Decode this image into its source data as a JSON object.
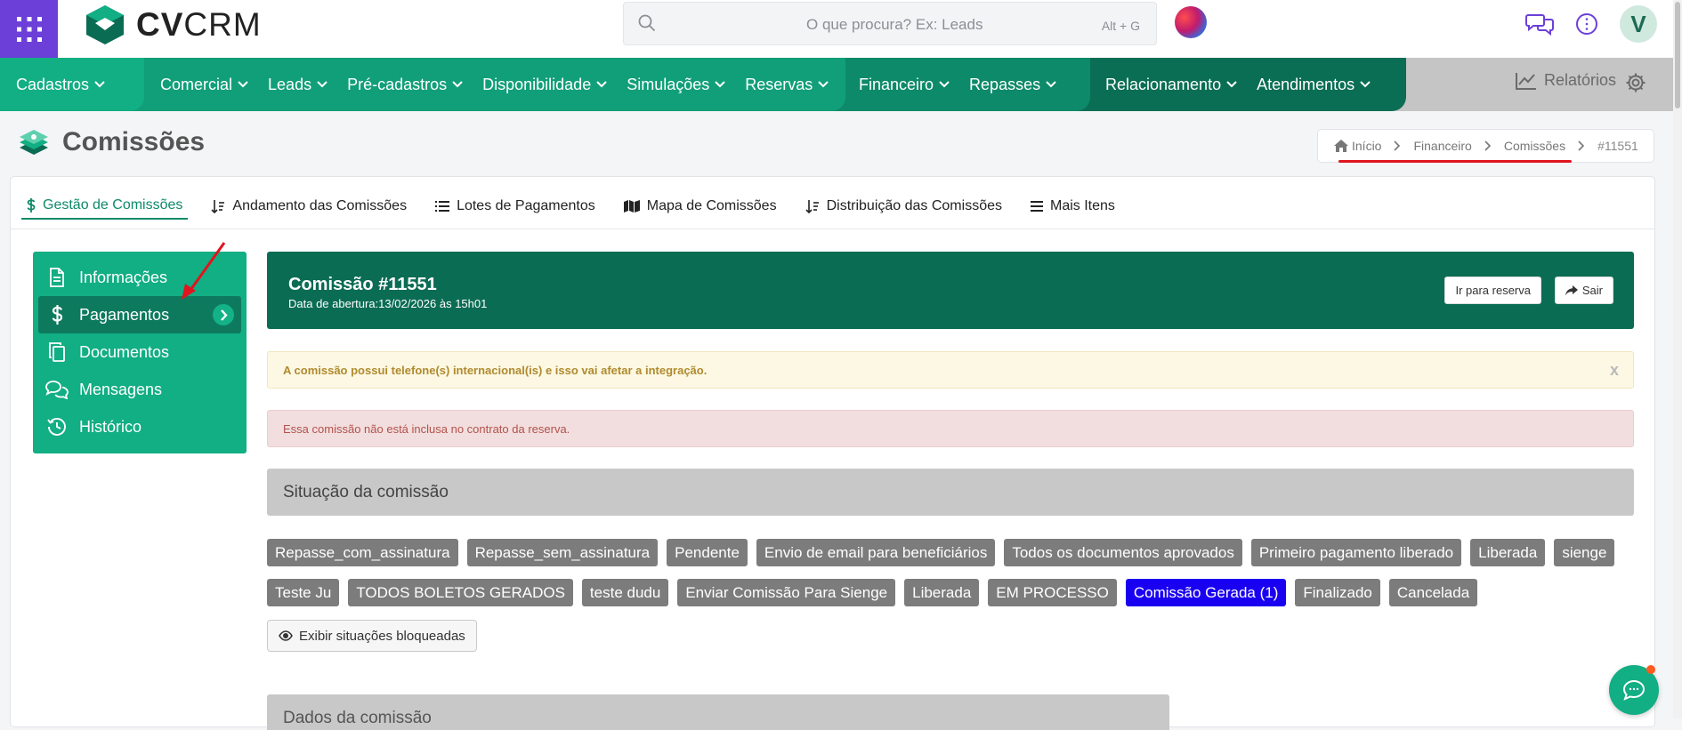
{
  "header": {
    "logo_text": "CVCRM",
    "search_placeholder": "O que procura? Ex: Leads",
    "search_shortcut": "Alt + G",
    "user_initial": "V"
  },
  "nav": {
    "group1": [
      "Cadastros"
    ],
    "group2": [
      "Comercial",
      "Leads",
      "Pré-cadastros",
      "Disponibilidade",
      "Simulações",
      "Reservas"
    ],
    "group3": [
      "Financeiro",
      "Repasses"
    ],
    "group4": [
      "Relacionamento",
      "Atendimentos"
    ],
    "reports_label": "Relatórios"
  },
  "page": {
    "title": "Comissões",
    "breadcrumb": [
      "Início",
      "Financeiro",
      "Comissões",
      "#11551"
    ]
  },
  "tabs": [
    "Gestão de Comissões",
    "Andamento das Comissões",
    "Lotes de Pagamentos",
    "Mapa de Comissões",
    "Distribuição das Comissões",
    "Mais Itens"
  ],
  "sidemenu": [
    "Informações",
    "Pagamentos",
    "Documentos",
    "Mensagens",
    "Histórico"
  ],
  "commission": {
    "title": "Comissão #11551",
    "subtitle": "Data de abertura:13/02/2026 às 15h01",
    "btn_reserva": "Ir para reserva",
    "btn_sair": "Sair"
  },
  "alerts": {
    "warning": "A comissão possui telefone(s) internacional(is) e isso vai afetar a integração.",
    "warning_close": "x",
    "danger": "Essa comissão não está inclusa no contrato da reserva."
  },
  "situacao": {
    "title": "Situação da comissão",
    "statuses": [
      "Repasse_com_assinatura",
      "Repasse_sem_assinatura",
      "Pendente",
      "Envio de email para beneficiários",
      "Todos os documentos aprovados",
      "Primeiro pagamento liberado",
      "Liberada",
      "sienge",
      "Teste Ju",
      "TODOS BOLETOS GERADOS",
      "teste dudu",
      "Enviar Comissão Para Sienge",
      "Liberada",
      "EM PROCESSO",
      "Comissão Gerada (1)",
      "Finalizado",
      "Cancelada"
    ],
    "active_status": "Comissão Gerada (1)",
    "show_blocked": "Exibir situações bloqueadas"
  },
  "dados": {
    "title": "Dados da comissão"
  },
  "colors": {
    "brand_green": "#12ae84",
    "dark_green": "#0b6c54",
    "purple": "#6c3fd9",
    "active_status": "#1a00f0"
  }
}
